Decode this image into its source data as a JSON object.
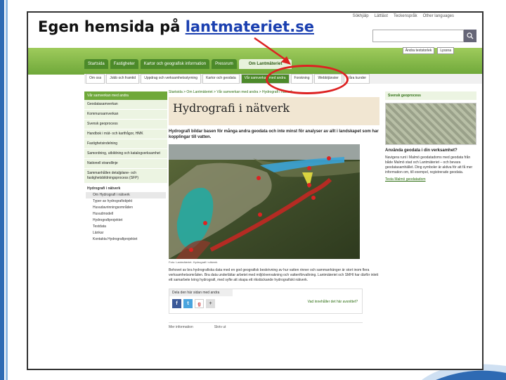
{
  "caption": {
    "prefix": "Egen hemsida på ",
    "link": "lantmateriet.se"
  },
  "topbar": {
    "links": [
      "Sökhjälp",
      "Lättläst",
      "Teckenspråk",
      "Other languages"
    ],
    "search_placeholder": "",
    "search_button_icon": "search-icon"
  },
  "accessibility": [
    "Ändra textstorlek",
    "Lyssna"
  ],
  "main_nav": [
    "Startsida",
    "Fastigheter",
    "Kartor och geografisk information",
    "Pressrum",
    "Om Lantmäteriet"
  ],
  "main_nav_active": "Om Lantmäteriet",
  "sub_nav": [
    "Om oss",
    "Jobb och framtid",
    "Uppdrag och verksamhetsstyrning",
    "Kartor och geodata",
    "Vår samverkan med andra",
    "Forskning",
    "Webbtjänster",
    "Våra kunder"
  ],
  "sub_nav_active": "Vår samverkan med andra",
  "left_menu": {
    "header": "Vår samverkan med andra",
    "items": [
      "Geodatasamverkan",
      "Kommunsamverkan",
      "Svensk geoprocess",
      "Handbok i mät- och kartfrågor, HMK",
      "Fastighetsindelning",
      "Samordning, utbildning och katalogverksamhet",
      "Nationell strandlinje",
      "Sammanhållen detaljplane- och fastighetsbildningsprocess (SFP)"
    ],
    "sub_header": "Hydrografi i nätverk",
    "sub_items": [
      "Om Hydrografi i nätverk",
      "Typer av hydrografiobjekt",
      "Huvudavrinningsområden",
      "Huvudmodell",
      "Hydrografiprojektet",
      "Testdata",
      "Länkar",
      "Kontakta Hydrografiprojektet"
    ],
    "sub_active": "Om Hydrografi i nätverk"
  },
  "content": {
    "breadcrumb": "Startsida > Om Lantmäteriet > Vår samverkan med andra > Hydrografi i nätverk",
    "title": "Hydrografi i nätverk",
    "lead": "Hydrografi bildar basen för många andra geodata och inte minst för analyser av allt i landskapet som har kopplingar till vatten.",
    "photo_caption": "Foto: Lantmäteriet. Hydrografi i nätverk",
    "body": "Behovet av bra hydrografiska data med en god geografisk beskrivning av hur vatten rinner och sammanhänger är stort inom flera verksamhetsområden. Bra data underlättar arbetet med miljöövervakning och vattenförvaltning. Lantmäteriet och SMHI har därför inlett ett samarbete kring hydrografi, med syfte att skapa ett rikstäckande hydrografiskt nätverk.",
    "share_header": "Dela den här sidan med andra",
    "share_question": "Vad innehåller det här avsnittet?",
    "footer_links": [
      "Mer information",
      "Skriv ut"
    ]
  },
  "right_box": {
    "header": "Svensk geoprocess",
    "question": "Använda geodata i din verksamhet?",
    "text": "Navigera runt i Malmö geodatadoms med geodata från både Malmö stad och Lantmäteriet – och bevara geodatasamhället. Ding symboler är aktiva för att få mer information om, till exempel, registrerade geodata.",
    "link": "Testa Malmö geodatadom"
  },
  "colors": {
    "accent_green": "#6fa83a",
    "nav_green": "#4c8a2a",
    "annotation_red": "#dd2222",
    "link_blue": "#1a3fb0"
  }
}
